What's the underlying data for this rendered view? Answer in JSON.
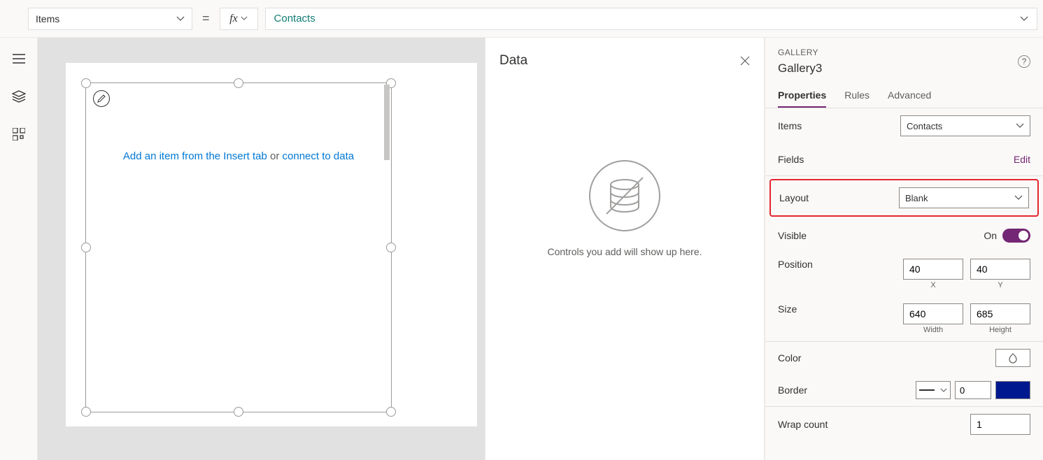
{
  "formula": {
    "property": "Items",
    "fx": "fx",
    "value": "Contacts"
  },
  "canvas": {
    "hint_link1": "Add an item from the Insert tab",
    "hint_or": " or ",
    "hint_link2": "connect to data"
  },
  "dataPane": {
    "title": "Data",
    "empty_msg": "Controls you add will show up here."
  },
  "props": {
    "category": "GALLERY",
    "name": "Gallery3",
    "tabs": {
      "properties": "Properties",
      "rules": "Rules",
      "advanced": "Advanced"
    },
    "items": {
      "label": "Items",
      "value": "Contacts"
    },
    "fields": {
      "label": "Fields",
      "edit": "Edit"
    },
    "layout": {
      "label": "Layout",
      "value": "Blank"
    },
    "visible": {
      "label": "Visible",
      "state": "On"
    },
    "position": {
      "label": "Position",
      "x": "40",
      "y": "40",
      "xl": "X",
      "yl": "Y"
    },
    "size": {
      "label": "Size",
      "w": "640",
      "h": "685",
      "wl": "Width",
      "hl": "Height"
    },
    "color": {
      "label": "Color"
    },
    "border": {
      "label": "Border",
      "width": "0"
    },
    "wrap": {
      "label": "Wrap count",
      "value": "1"
    }
  }
}
